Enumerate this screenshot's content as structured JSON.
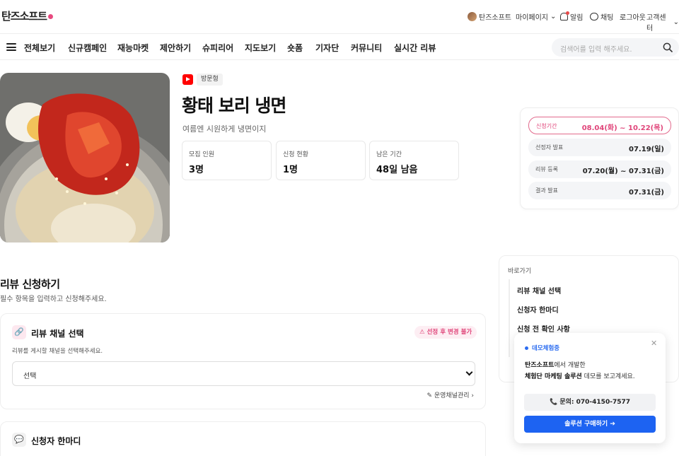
{
  "header": {
    "logo": "탄즈소프트",
    "user_name": "탄즈소프트",
    "mypage": "마이페이지",
    "alerts": "알림",
    "chat": "채팅",
    "logout": "로그아웃",
    "support": "고객센터"
  },
  "nav": {
    "items": [
      {
        "label": "전체보기"
      },
      {
        "label": "신규캠페인"
      },
      {
        "label": "재능마켓"
      },
      {
        "label": "제안하기"
      },
      {
        "label": "슈피리어"
      },
      {
        "label": "지도보기"
      },
      {
        "label": "숏폼"
      },
      {
        "label": "기자단"
      },
      {
        "label": "커뮤니티"
      },
      {
        "label": "실시간 리뷰"
      }
    ],
    "search_placeholder": "검색어를 입력 해주세요."
  },
  "product": {
    "type_badge": "방문형",
    "title": "황태 보리 냉면",
    "subtitle": "여름엔 시원하게 냉면이지",
    "stats": [
      {
        "label": "모집 인원",
        "value": "3명"
      },
      {
        "label": "신청 현황",
        "value": "1명"
      },
      {
        "label": "남은 기간",
        "value": "48일 남음"
      }
    ]
  },
  "schedule": [
    {
      "label": "신청기간",
      "value": "08.04(화) ~ 10.22(목)"
    },
    {
      "label": "선정자 발표",
      "value": "07.19(일)"
    },
    {
      "label": "리뷰 등록",
      "value": "07.20(월) ~ 07.31(금)"
    },
    {
      "label": "결과 발표",
      "value": "07.31(금)"
    }
  ],
  "quick_links": {
    "title": "바로가기",
    "items": [
      {
        "label": "리뷰 채널 선택"
      },
      {
        "label": "신청자 한마디"
      },
      {
        "label": "신청 전 확인 사항"
      }
    ]
  },
  "review": {
    "title": "리뷰 신청하기",
    "subtitle": "필수 항목을 입력하고 신청해주세요.",
    "channel": {
      "title": "리뷰 채널 선택",
      "warning": "선정 후 변경 불가",
      "desc": "리뷰를 게시할 채널을 선택해주세요.",
      "select_value": "선택",
      "manage": "운영채널관리"
    },
    "comment": {
      "title": "신청자 한마디"
    }
  },
  "popup": {
    "tag": "데모체험중",
    "line1_brand": "탄즈소프트",
    "line1_rest": "에서 개발한",
    "line2_brand": "체험단 마케팅 솔루션",
    "line2_rest": " 데모를 보고계세요.",
    "call": "📞 문의: 070-4150-7577",
    "buy": "솔루션 구매하기 ➔"
  },
  "colors": {
    "accent": "#e0457a",
    "primary": "#1d63f2"
  }
}
